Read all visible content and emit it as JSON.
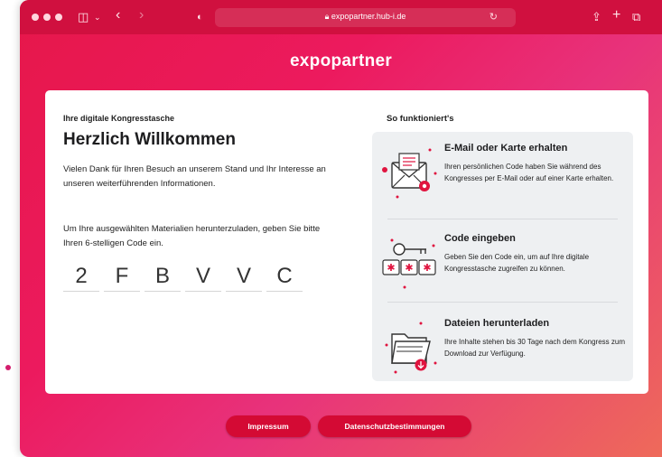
{
  "browser": {
    "url": "expopartner.hub-i.de"
  },
  "brand": "expopartner",
  "left": {
    "kicker": "Ihre digitale Kongresstasche",
    "headline": "Herzlich Willkommen",
    "intro": "Vielen Dank für Ihren Besuch an unserem Stand und Ihr Interesse an unseren weiterführenden Informationen.",
    "instruction": "Um Ihre ausgewählten Materialien herunterzuladen, geben Sie bitte Ihren 6-stelligen Code ein.",
    "code": [
      "2",
      "F",
      "B",
      "V",
      "V",
      "C"
    ]
  },
  "how": {
    "title": "So funktioniert's",
    "steps": [
      {
        "title": "E-Mail oder Karte erhalten",
        "text": "Ihren persönlichen Code haben Sie während des Kongresses per E-Mail oder auf einer Karte erhalten.",
        "icon": "envelope-icon"
      },
      {
        "title": "Code eingeben",
        "text": "Geben Sie den Code ein, um auf Ihre digitale Kongresstasche zugreifen zu können.",
        "icon": "key-code-icon"
      },
      {
        "title": "Dateien herunterladen",
        "text": "Ihre Inhalte stehen bis 30 Tage nach dem Kongress zum Download zur Verfügung.",
        "icon": "folder-download-icon"
      }
    ]
  },
  "footer": {
    "imprint": "Impressum",
    "privacy": "Datenschutzbestimmungen"
  },
  "colors": {
    "accent": "#d40a34",
    "gradient_start": "#e6174a",
    "gradient_end": "#ee6a5a",
    "panel": "#eef0f2"
  }
}
